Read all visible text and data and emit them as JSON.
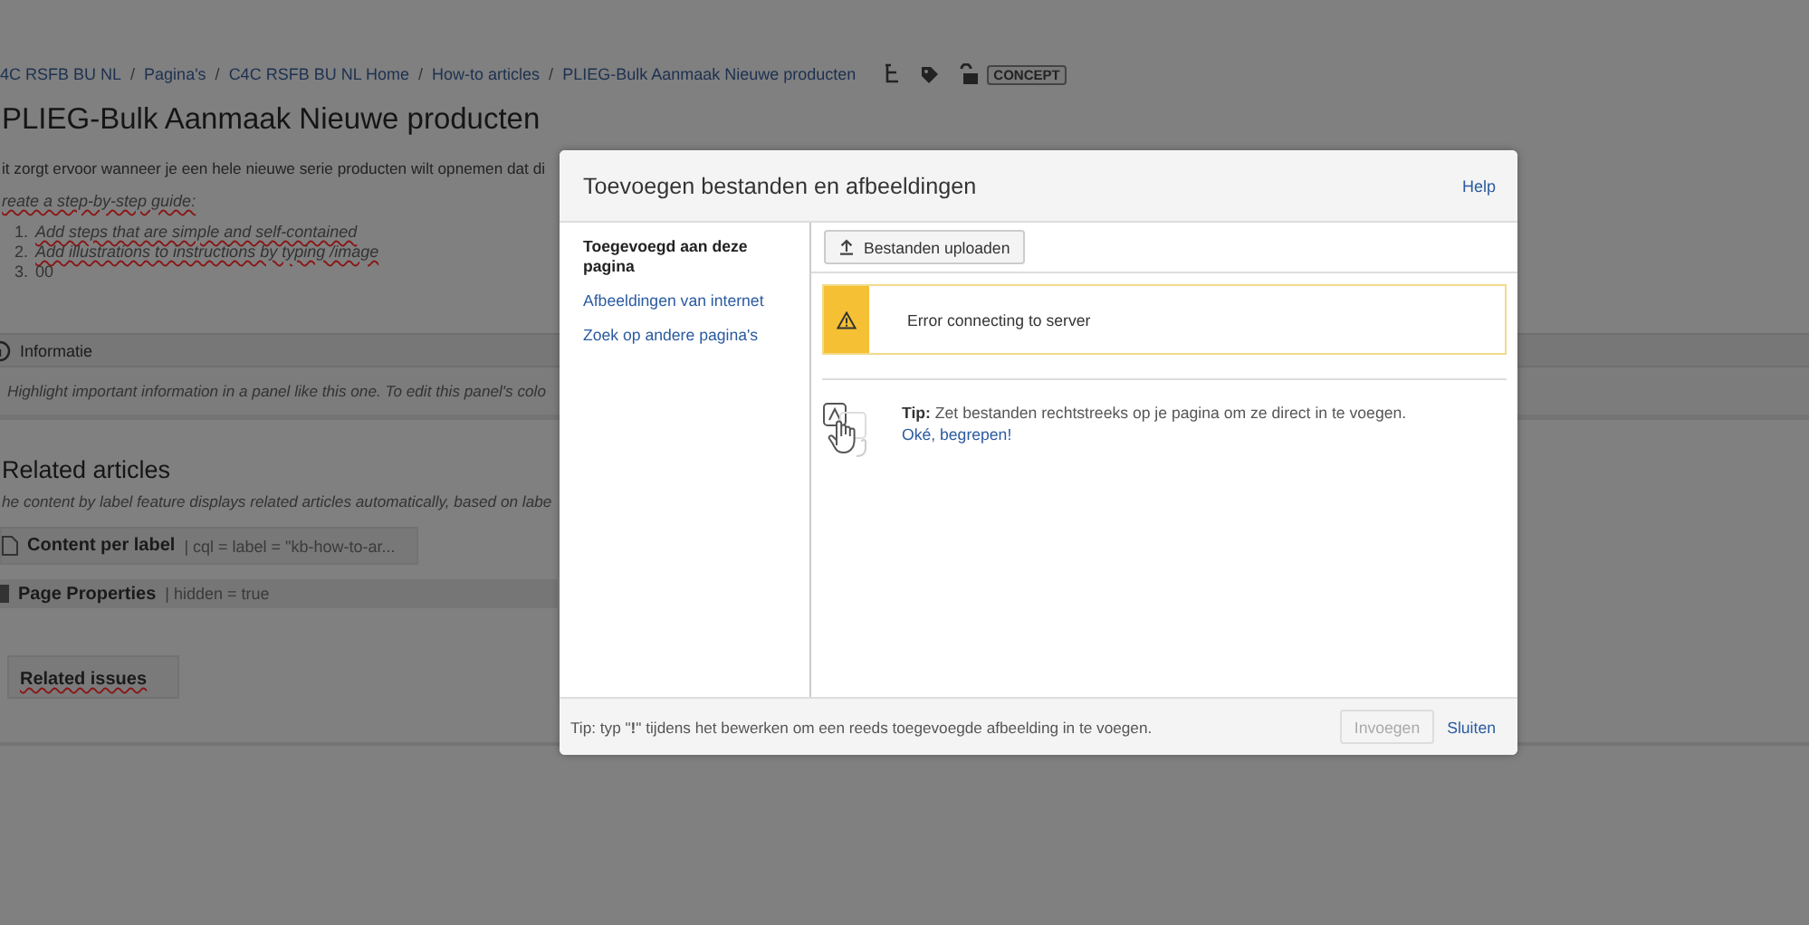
{
  "page": {
    "breadcrumbs": [
      "4C RSFB BU NL",
      "Pagina's",
      "C4C RSFB BU NL Home",
      "How-to articles",
      "PLIEG-Bulk Aanmaak Nieuwe producten"
    ],
    "breadcrumb_separators": [
      "/",
      "/",
      "/",
      "/"
    ],
    "status_badge": "CONCEPT",
    "title": "PLIEG-Bulk Aanmaak Nieuwe producten",
    "intro": "it zorgt ervoor wanneer je een hele nieuwe serie producten wilt opnemen dat di",
    "instruction": "reate a step-by-step guide:",
    "steps": [
      {
        "number": "1.",
        "text": "Add steps that are simple and self-contained"
      },
      {
        "number": "2.",
        "text": "Add illustrations to instructions by typing /image"
      },
      {
        "number": "3.",
        "text": "00"
      }
    ],
    "info_panel": {
      "title": "Informatie",
      "body": "Highlight important information in a panel like this one. To edit this panel's colo"
    },
    "related_heading": "Related articles",
    "related_text": "he content by label feature displays related articles automatically, based on labe",
    "macros": [
      {
        "kind": "box",
        "name": "Content per label",
        "params": "| cql = label = \"kb-how-to-ar..."
      },
      {
        "kind": "band",
        "name": "Page Properties",
        "params": "| hidden = true"
      }
    ],
    "related_issues": "Related issues"
  },
  "dialog": {
    "title": "Toevoegen bestanden en afbeeldingen",
    "help": "Help",
    "nav": [
      {
        "label": "Toegevoegd aan deze pagina",
        "selected": true
      },
      {
        "label": "Afbeeldingen van internet",
        "selected": false
      },
      {
        "label": "Zoek op andere pagina's",
        "selected": false
      }
    ],
    "upload_button": "Bestanden uploaden",
    "error": "Error connecting to server",
    "tip": "**Tip:** Zet bestanden rechtstreeks op je pagina om ze direct in te voegen.",
    "tip_link": "Oké, begrepen!",
    "footer_tip": "Tip: typ \"**!**\" tijdens het bewerken om een reeds toegevoegde afbeelding in te voegen.",
    "buttons": [
      {
        "label": "Invoegen",
        "disabled": true
      },
      {
        "label": "Sluiten",
        "disabled": false
      }
    ]
  }
}
